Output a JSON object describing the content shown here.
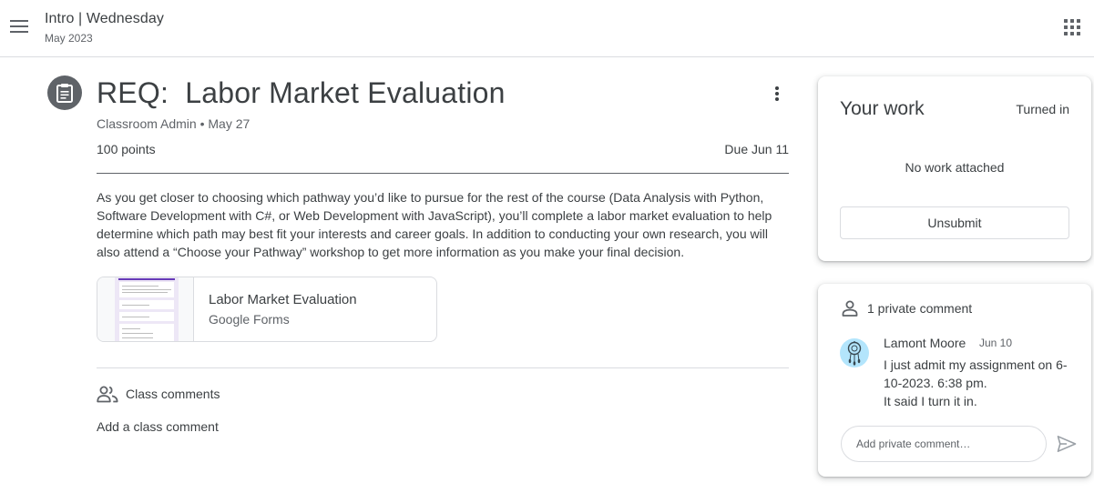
{
  "header": {
    "class_title": "Intro | Wednesday",
    "class_subtitle": "May 2023",
    "menu_icon": "hamburger-menu-icon",
    "apps_icon": "google-apps-grid-icon"
  },
  "assignment": {
    "icon": "assignment-clipboard-icon",
    "title": "REQ:  Labor Market Evaluation",
    "meta": "Classroom Admin • May 27",
    "points": "100 points",
    "due": "Due Jun 11",
    "description": "As you get closer to choosing which pathway you’d like to pursue for the rest of the course (Data Analysis with Python, Software Development with C#, or Web Development with JavaScript), you’ll complete a labor market evaluation to help determine which path may best fit your interests and career goals. In addition to conducting your own research, you will also attend a “Choose your Pathway” workshop to get more information as you make your final decision.",
    "attachment": {
      "title": "Labor Market Evaluation",
      "type": "Google Forms"
    }
  },
  "class_comments": {
    "label": "Class comments",
    "add_label": "Add a class comment"
  },
  "your_work": {
    "title": "Your work",
    "status": "Turned in",
    "empty_text": "No work attached",
    "unsubmit_label": "Unsubmit"
  },
  "private_comments": {
    "header": "1 private comment",
    "comment": {
      "author": "Lamont Moore",
      "date": "Jun 10",
      "lines": [
        "I just admit my assignment on 6-10-2023. 6:38 pm.",
        "It said I turn it in."
      ]
    },
    "input_placeholder": "Add private comment…"
  },
  "colors": {
    "text_primary": "#3c4043",
    "text_secondary": "#5f6368",
    "divider": "#dadce0",
    "forms_purple": "#673ab7",
    "avatar_bg": "#b3e5fc"
  }
}
